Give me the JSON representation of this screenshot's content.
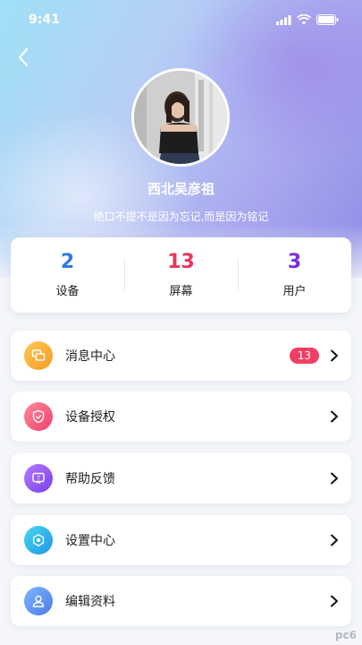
{
  "status_bar": {
    "time": "9:41"
  },
  "profile": {
    "name": "西北吴彦祖",
    "motto": "绝口不提不是因为忘记,而是因为铭记"
  },
  "stats": [
    {
      "value": "2",
      "label": "设备",
      "color": "#2f7ae8"
    },
    {
      "value": "13",
      "label": "屏幕",
      "color": "#e8365f"
    },
    {
      "value": "3",
      "label": "用户",
      "color": "#7a2fe0"
    }
  ],
  "menu": [
    {
      "label": "消息中心",
      "icon": "message-icon",
      "badge": "13"
    },
    {
      "label": "设备授权",
      "icon": "shield-icon"
    },
    {
      "label": "帮助反馈",
      "icon": "help-icon"
    },
    {
      "label": "设置中心",
      "icon": "settings-icon"
    },
    {
      "label": "编辑资料",
      "icon": "user-icon"
    }
  ],
  "watermark": "pc6"
}
